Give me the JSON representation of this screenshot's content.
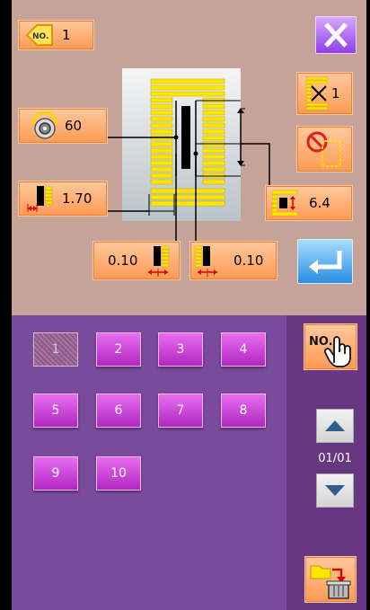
{
  "pattern_no": {
    "badge": "NO.",
    "value": "1"
  },
  "close": {
    "icon": "close-icon"
  },
  "repeat": {
    "value": "1"
  },
  "speed": {
    "value": "60"
  },
  "width": {
    "value": "1.70"
  },
  "length": {
    "value": "6.4"
  },
  "offset_left": {
    "value": "0.10"
  },
  "offset_right": {
    "value": "0.10"
  },
  "grid": {
    "items": [
      "1",
      "2",
      "3",
      "4",
      "5",
      "6",
      "7",
      "8",
      "9",
      "10"
    ],
    "selected": "1"
  },
  "no_select": {
    "badge": "NO."
  },
  "pager": {
    "page": "01/01"
  },
  "colors": {
    "accent_orange": "#ff9a52",
    "panel_top": "#c5a398",
    "panel_bottom": "#7a4b9c",
    "button_purple": "#c03fd0"
  }
}
